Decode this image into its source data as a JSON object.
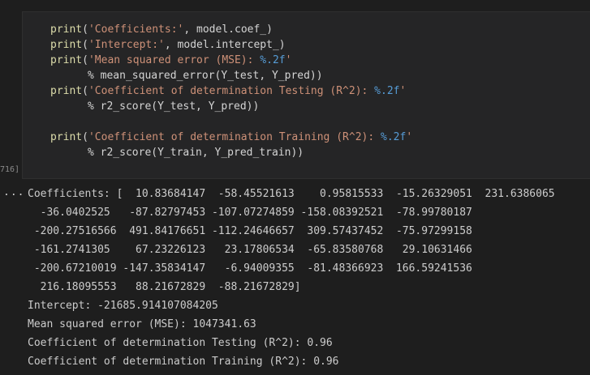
{
  "cell": {
    "execution_count": "716]",
    "code_lines": [
      {
        "indent": 0,
        "fn": "print",
        "open": "(",
        "str": "'Coefficients:'",
        "rest": ", model.coef_)"
      },
      {
        "indent": 0,
        "fn": "print",
        "open": "(",
        "str": "'Intercept:'",
        "rest": ", model.intercept_)"
      },
      {
        "indent": 0,
        "fn": "print",
        "open": "(",
        "str": "'Mean squared error (MSE): ",
        "fmt": "%.2f",
        "strend": "'",
        "rest": ""
      },
      {
        "indent": 1,
        "text": "% mean_squared_error(Y_test, Y_pred))"
      },
      {
        "indent": 0,
        "fn": "print",
        "open": "(",
        "str": "'Coefficient of determination Testing (R^2): ",
        "fmt": "%.2f",
        "strend": "'",
        "rest": ""
      },
      {
        "indent": 1,
        "text": "% r2_score(Y_test, Y_pred))"
      },
      {
        "indent": 0,
        "fn": "print",
        "open": "(",
        "str": "'Coefficient of determination Training (R^2): ",
        "fmt": "%.2f",
        "strend": "'",
        "rest": ""
      },
      {
        "indent": 1,
        "text": "% r2_score(Y_train, Y_pred_train))"
      }
    ]
  },
  "output": {
    "ellipsis": "...",
    "lines": [
      "Coefficients: [  10.83684147  -58.45521613    0.95815533  -15.26329051  231.6386065",
      "  -36.0402525   -87.82797453 -107.07274859 -158.08392521  -78.99780187",
      " -200.27516566  491.84176651 -112.24646657  309.57437452  -75.97299158",
      " -161.2741305    67.23226123   23.17806534  -65.83580768   29.10631466",
      " -200.67210019 -147.35834147   -6.94009355  -81.48366923  166.59241536",
      "  216.18095553   88.21672829  -88.21672829]",
      "Intercept: -21685.914107084205",
      "Mean squared error (MSE): 1047341.63",
      "Coefficient of determination Testing (R^2): 0.96",
      "Coefficient of determination Training (R^2): 0.96"
    ]
  }
}
